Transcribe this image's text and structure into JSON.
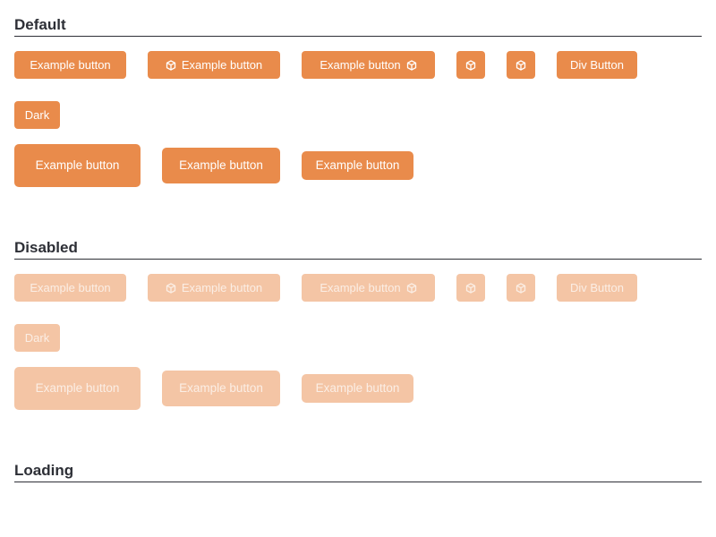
{
  "sections": {
    "default": {
      "title": "Default"
    },
    "disabled": {
      "title": "Disabled"
    },
    "loading": {
      "title": "Loading"
    }
  },
  "buttons": {
    "example_label": "Example button",
    "div_label": "Div Button",
    "dark_label": "Dark"
  },
  "icons": {
    "cube": "cube-icon"
  },
  "colors": {
    "primary": "#e98b4b",
    "disabled": "#f4c5a5",
    "text_on_primary": "#ffffff",
    "heading": "#2d2f36"
  }
}
